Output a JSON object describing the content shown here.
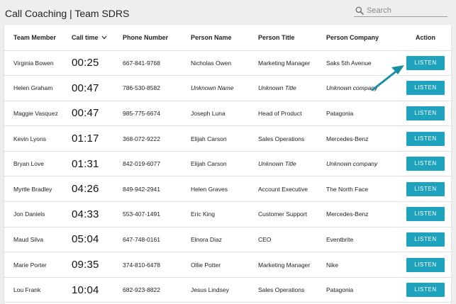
{
  "app": {
    "title": "Call Coaching | Team SDRS"
  },
  "search": {
    "placeholder": "Search",
    "icon": "search-icon"
  },
  "table": {
    "columns": {
      "member": "Team Member",
      "time": "Call time",
      "phone": "Phone Number",
      "person_name": "Person Name",
      "person_title": "Person Title",
      "person_company": "Person Company",
      "action": "Action"
    },
    "sort_icon": "chevron-down-icon",
    "rows": [
      {
        "member": "Virginia Bowen",
        "time": "00:25",
        "phone": "667-841-9768",
        "name": "Nicholas Owen",
        "title": "Marketing Manager",
        "company": "Saks 5th Avenue",
        "action": "LISTEN"
      },
      {
        "member": "Helen Graham",
        "time": "00:47",
        "phone": "786-530-8582",
        "name": "Unknown Name",
        "title": "Unknown Title",
        "company": "Unknown company",
        "action": "LISTEN"
      },
      {
        "member": "Maggie Vasquez",
        "time": "00:47",
        "phone": "985-775-6674",
        "name": "Joseph Luna",
        "title": "Head of Product",
        "company": "Patagonia",
        "action": "LISTEN"
      },
      {
        "member": "Kevin Lyons",
        "time": "01:17",
        "phone": "368-072-9222",
        "name": "Elijah Carson",
        "title": "Sales Operations",
        "company": "Mercedes-Benz",
        "action": "LISTEN"
      },
      {
        "member": "Bryan Love",
        "time": "01:31",
        "phone": "842-019-6077",
        "name": "Elijah Carson",
        "title": "Unknown Title",
        "company": "Unknown company",
        "action": "LISTEN"
      },
      {
        "member": "Myrtle Bradley",
        "time": "04:26",
        "phone": "849-942-2941",
        "name": "Helen Graves",
        "title": "Account Executive",
        "company": "The North Face",
        "action": "LISTEN"
      },
      {
        "member": "Jon Daniels",
        "time": "04:33",
        "phone": "553-407-1491",
        "name": "Eric King",
        "title": "Customer Support",
        "company": "Mercedes-Benz",
        "action": "LISTEN"
      },
      {
        "member": "Maud Silva",
        "time": "05:04",
        "phone": "647-748-0161",
        "name": "Elnora Diaz",
        "title": "CEO",
        "company": "Eventbrite",
        "action": "LISTEN"
      },
      {
        "member": "Marie Porter",
        "time": "09:35",
        "phone": "374-810-6478",
        "name": "Ollie Potter",
        "title": "Marketing Manager",
        "company": "Nike",
        "action": "LISTEN"
      },
      {
        "member": "Lou Frank",
        "time": "10:04",
        "phone": "682-923-8822",
        "name": "Jesus Lindsey",
        "title": "Sales Operations",
        "company": "Patagonia",
        "action": "LISTEN"
      }
    ]
  },
  "colors": {
    "accent": "#1ea2bd",
    "arrow": "#1a8ea1",
    "background": "#eeeeee"
  }
}
